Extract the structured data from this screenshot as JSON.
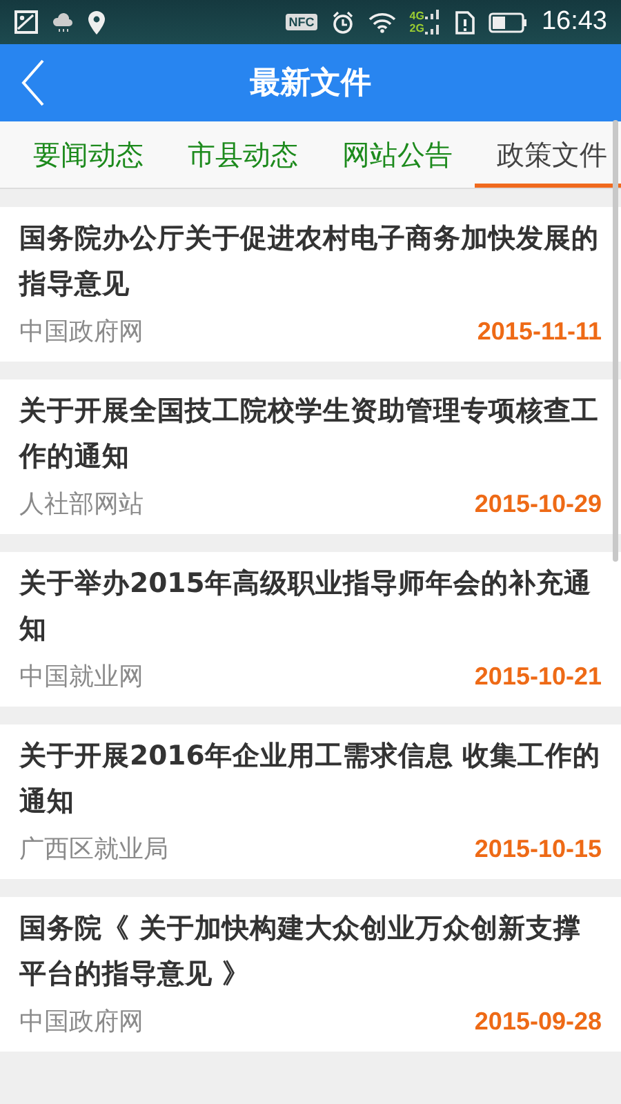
{
  "status_bar": {
    "nfc": "NFC",
    "network_top": "4G",
    "network_bottom": "2G",
    "time": "16:43"
  },
  "app_bar": {
    "title": "最新文件"
  },
  "tabs": [
    {
      "label": "要闻动态",
      "selected": false
    },
    {
      "label": "市县动态",
      "selected": false
    },
    {
      "label": "网站公告",
      "selected": false
    },
    {
      "label": "政策文件",
      "selected": true
    }
  ],
  "articles": [
    {
      "title": "国务院办公厅关于促进农村电子商务加快发展的指导意见",
      "source": "中国政府网",
      "date": "2015-11-11"
    },
    {
      "title": "关于开展全国技工院校学生资助管理专项核查工作的通知",
      "source": "人社部网站",
      "date": "2015-10-29"
    },
    {
      "title": "关于举办2015年高级职业指导师年会的补充通知",
      "source": "中国就业网",
      "date": "2015-10-21"
    },
    {
      "title": "关于开展2016年企业用工需求信息 收集工作的通知",
      "source": "广西区就业局",
      "date": "2015-10-15"
    },
    {
      "title": "国务院《 关于加快构建大众创业万众创新支撑平台的指导意见 》",
      "source": "中国政府网",
      "date": "2015-09-28"
    }
  ]
}
